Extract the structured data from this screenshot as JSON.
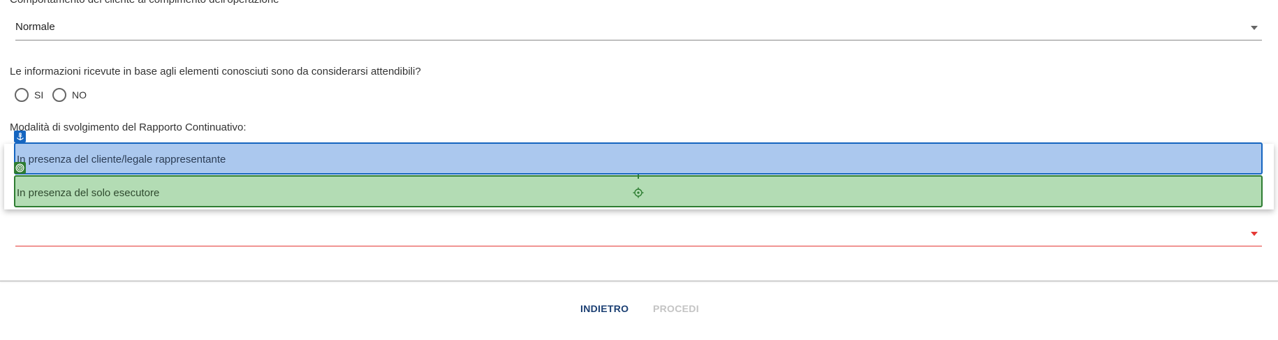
{
  "form": {
    "previous_field_label": "Comportamento del cliente al compimento dell'operazione",
    "behaviour_select": {
      "value": "Normale"
    },
    "reliability_question": "Le informazioni ricevute in base agli elementi conosciuti sono da considerarsi attendibili?",
    "reliability_options": [
      {
        "label": "SI",
        "selected": false
      },
      {
        "label": "NO",
        "selected": false
      }
    ],
    "mode_label": "Modalità di svolgimento del Rapporto Continuativo:",
    "mode_options": [
      {
        "label": "In presenza del cliente/legale rappresentante",
        "highlight_color": "#1565c0"
      },
      {
        "label": "In presenza del solo esecutore",
        "highlight_color": "#2e7d32"
      }
    ],
    "mode_select": {
      "value": "",
      "state": "error",
      "error_color": "#e53935"
    }
  },
  "annotations": {
    "anchor_badge_icon": "anchor-icon",
    "target_badge_icon": "target-icon",
    "center_marker_icon": "crosshair-icon"
  },
  "footer": {
    "back_label": "INDIETRO",
    "next_label": "PROCEDI",
    "back_color": "#1b3f73",
    "next_disabled": true
  }
}
